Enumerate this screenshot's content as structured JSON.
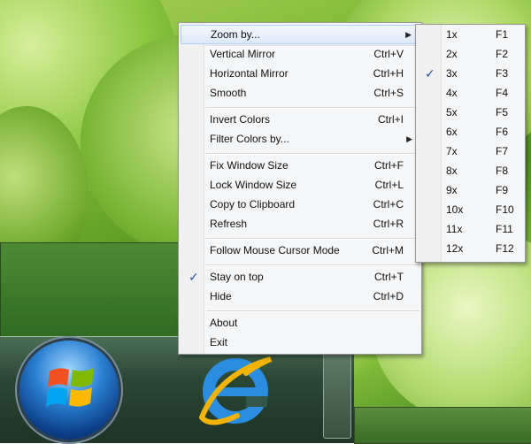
{
  "main_menu": {
    "items": [
      {
        "label": "Zoom by...",
        "shortcut": "",
        "submenu": true,
        "checked": false
      },
      {
        "label": "Vertical Mirror",
        "shortcut": "Ctrl+V"
      },
      {
        "label": "Horizontal Mirror",
        "shortcut": "Ctrl+H"
      },
      {
        "label": "Smooth",
        "shortcut": "Ctrl+S"
      },
      {
        "label": "Invert Colors",
        "shortcut": "Ctrl+I"
      },
      {
        "label": "Filter Colors by...",
        "shortcut": "",
        "submenu": true
      },
      {
        "label": "Fix Window Size",
        "shortcut": "Ctrl+F"
      },
      {
        "label": "Lock Window Size",
        "shortcut": "Ctrl+L"
      },
      {
        "label": "Copy to Clipboard",
        "shortcut": "Ctrl+C"
      },
      {
        "label": "Refresh",
        "shortcut": "Ctrl+R"
      },
      {
        "label": "Follow Mouse Cursor Mode",
        "shortcut": "Ctrl+M"
      },
      {
        "label": "Stay on top",
        "shortcut": "Ctrl+T",
        "checked": true
      },
      {
        "label": "Hide",
        "shortcut": "Ctrl+D"
      },
      {
        "label": "About",
        "shortcut": ""
      },
      {
        "label": "Exit",
        "shortcut": ""
      }
    ],
    "check_glyph": "✓",
    "arrow_glyph": "▶"
  },
  "zoom_submenu": {
    "items": [
      {
        "label": "1x",
        "shortcut": "F1"
      },
      {
        "label": "2x",
        "shortcut": "F2"
      },
      {
        "label": "3x",
        "shortcut": "F3",
        "checked": true
      },
      {
        "label": "4x",
        "shortcut": "F4"
      },
      {
        "label": "5x",
        "shortcut": "F5"
      },
      {
        "label": "6x",
        "shortcut": "F6"
      },
      {
        "label": "7x",
        "shortcut": "F7"
      },
      {
        "label": "8x",
        "shortcut": "F8"
      },
      {
        "label": "9x",
        "shortcut": "F9"
      },
      {
        "label": "10x",
        "shortcut": "F10"
      },
      {
        "label": "11x",
        "shortcut": "F11"
      },
      {
        "label": "12x",
        "shortcut": "F12"
      }
    ]
  },
  "taskbar": {
    "start_icon": "windows-logo-icon",
    "pinned_icon": "internet-explorer-icon"
  },
  "colors": {
    "menu_bg": "#f5f6f7",
    "highlight": "#dde9fa",
    "check": "#2450a6"
  }
}
